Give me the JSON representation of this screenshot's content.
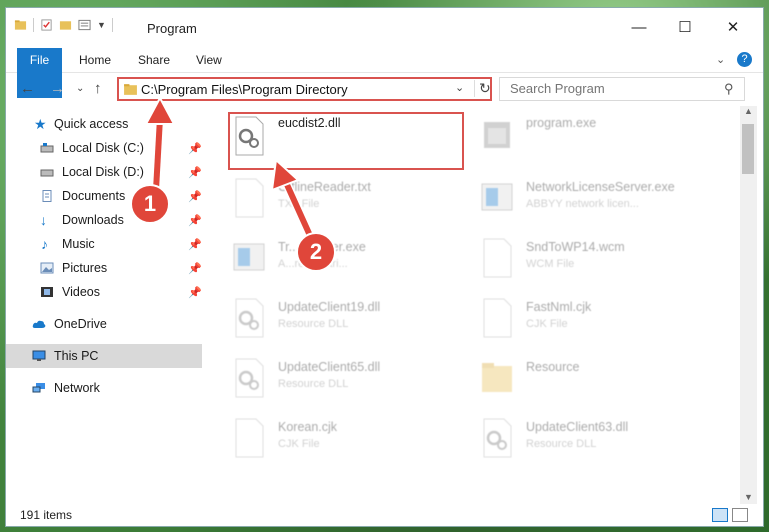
{
  "window": {
    "title": "Program"
  },
  "ribbon": {
    "tabs": [
      "File",
      "Home",
      "Share",
      "View"
    ]
  },
  "address": {
    "path": "C:\\Program Files\\Program Directory"
  },
  "search": {
    "placeholder": "Search Program"
  },
  "sidebar": {
    "items": [
      {
        "label": "Quick access",
        "icon": "star-icon"
      },
      {
        "label": "Local Disk (C:)",
        "icon": "drive-icon"
      },
      {
        "label": "Local Disk (D:)",
        "icon": "drive-icon"
      },
      {
        "label": "Documents",
        "icon": "documents-icon"
      },
      {
        "label": "Downloads",
        "icon": "download-icon"
      },
      {
        "label": "Music",
        "icon": "music-icon"
      },
      {
        "label": "Pictures",
        "icon": "pictures-icon"
      },
      {
        "label": "Videos",
        "icon": "videos-icon"
      },
      {
        "label": "OneDrive",
        "icon": "cloud-icon"
      },
      {
        "label": "This PC",
        "icon": "computer-icon"
      },
      {
        "label": "Network",
        "icon": "network-icon"
      }
    ]
  },
  "files": [
    {
      "name": "eucdist2.dll",
      "type": ""
    },
    {
      "name": "program.exe",
      "type": ""
    },
    {
      "name": "OfflineReader.txt",
      "type": "TXT File"
    },
    {
      "name": "NetworkLicenseServer.exe",
      "type": "ABBYY network licen..."
    },
    {
      "name": "Tr...Installer.exe",
      "type": "A...reader tri..."
    },
    {
      "name": "SndToWP14.wcm",
      "type": "WCM File"
    },
    {
      "name": "UpdateClient19.dll",
      "type": "Resource DLL"
    },
    {
      "name": "FastNml.cjk",
      "type": "CJK File"
    },
    {
      "name": "UpdateClient65.dll",
      "type": "Resource DLL"
    },
    {
      "name": "Resource",
      "type": ""
    },
    {
      "name": "Korean.cjk",
      "type": "CJK File"
    },
    {
      "name": "UpdateClient63.dll",
      "type": "Resource DLL"
    }
  ],
  "status": {
    "count": "191 items"
  },
  "annotations": {
    "step1": "1",
    "step2": "2"
  },
  "colors": {
    "accent": "#1979ca",
    "highlight": "#d9534f"
  }
}
